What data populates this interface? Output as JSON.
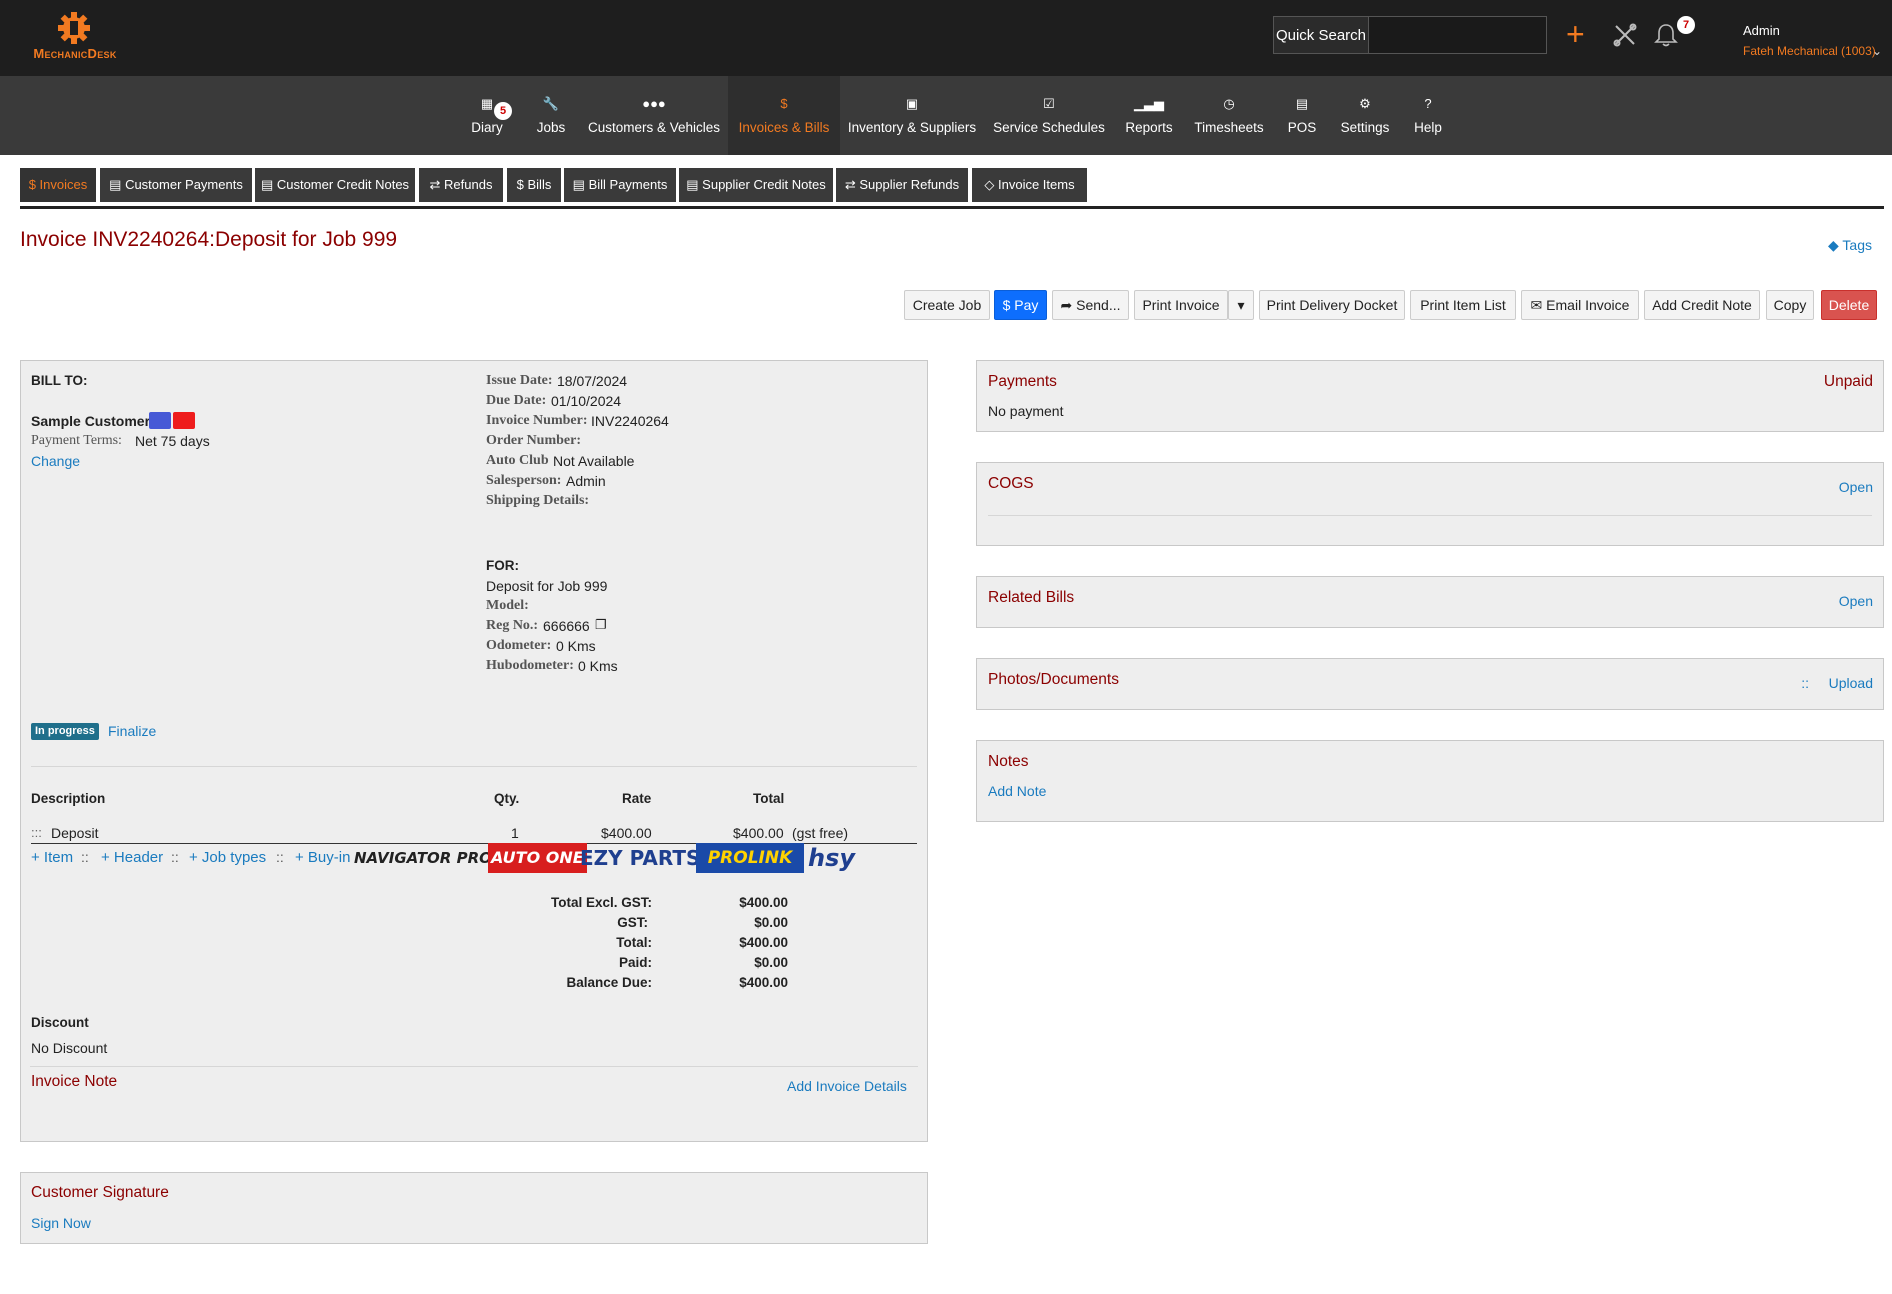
{
  "app": {
    "logo_text": "MechanicDesk"
  },
  "header": {
    "quick_search_label": "Quick Search",
    "quick_search_value": "",
    "notification_count": "7",
    "user_name": "Admin",
    "user_org": "Fateh Mechanical (1003)"
  },
  "nav": {
    "items": [
      {
        "label": "Diary",
        "icon": "calendar-icon",
        "badge": "5"
      },
      {
        "label": "Jobs",
        "icon": "wrench-icon"
      },
      {
        "label": "Customers & Vehicles",
        "icon": "users-icon"
      },
      {
        "label": "Invoices & Bills",
        "icon": "dollar-icon",
        "active": true
      },
      {
        "label": "Inventory & Suppliers",
        "icon": "warehouse-icon"
      },
      {
        "label": "Service Schedules",
        "icon": "calendar-check-icon"
      },
      {
        "label": "Reports",
        "icon": "chart-icon"
      },
      {
        "label": "Timesheets",
        "icon": "clock-icon"
      },
      {
        "label": "POS",
        "icon": "store-icon"
      },
      {
        "label": "Settings",
        "icon": "gear-icon"
      },
      {
        "label": "Help",
        "icon": "question-icon"
      }
    ]
  },
  "subtabs": {
    "items": [
      {
        "label": "$ Invoices",
        "active": true
      },
      {
        "label": "Customer Payments"
      },
      {
        "label": "Customer Credit Notes"
      },
      {
        "label": "Refunds"
      },
      {
        "label": "$ Bills"
      },
      {
        "label": "Bill Payments"
      },
      {
        "label": "Supplier Credit Notes"
      },
      {
        "label": "Supplier Refunds"
      },
      {
        "label": "Invoice Items"
      }
    ]
  },
  "page": {
    "title": "Invoice INV2240264:Deposit for Job 999",
    "tags_label": "Tags"
  },
  "actions": {
    "create_job": "Create Job",
    "pay": "$ Pay",
    "send": "Send...",
    "print_invoice": "Print Invoice",
    "print_delivery_docket": "Print Delivery Docket",
    "print_item_list": "Print Item List",
    "email_invoice": "Email Invoice",
    "add_credit_note": "Add Credit Note",
    "copy": "Copy",
    "delete": "Delete"
  },
  "bill_to": {
    "heading": "BILL TO:",
    "customer_name": "Sample Customer",
    "payment_terms_label": "Payment Terms:",
    "payment_terms": "Net 75 days",
    "change_label": "Change"
  },
  "invoice_info": {
    "issue_date_label": "Issue Date:",
    "issue_date": "18/07/2024",
    "due_date_label": "Due Date:",
    "due_date": "01/10/2024",
    "invoice_number_label": "Invoice Number:",
    "invoice_number": "INV2240264",
    "order_number_label": "Order Number:",
    "auto_club_label": "Auto Club",
    "auto_club": "Not Available",
    "salesperson_label": "Salesperson:",
    "salesperson": "Admin",
    "shipping_label": "Shipping Details:"
  },
  "for_info": {
    "heading": "FOR:",
    "description": "Deposit for Job 999",
    "model_label": "Model:",
    "reg_label": "Reg No.:",
    "reg": "666666",
    "odometer_label": "Odometer:",
    "odometer": "0 Kms",
    "hubodometer_label": "Hubodometer:",
    "hubodometer": "0 Kms"
  },
  "status": {
    "badge": "In progress",
    "finalize_label": "Finalize"
  },
  "items_table": {
    "headers": [
      "Description",
      "Qty.",
      "Rate",
      "Total"
    ],
    "rows": [
      {
        "handle": ":::",
        "description": "Deposit",
        "qty": "1",
        "rate": "$400.00",
        "total": "$400.00",
        "note": "(gst free)"
      }
    ],
    "add_links": [
      "+ Item",
      "+ Header",
      "+ Job types",
      "+ Buy-in"
    ],
    "separator": "::",
    "suppliers": [
      "NAVIGATOR PRO",
      "AUTO ONE",
      "EZY PARTS",
      "PROLINK",
      "hsy"
    ]
  },
  "totals": [
    {
      "label": "Total Excl. GST:",
      "value": "$400.00"
    },
    {
      "label": "GST:",
      "value": "$0.00"
    },
    {
      "label": "Total:",
      "value": "$400.00"
    },
    {
      "label": "Paid:",
      "value": "$0.00"
    },
    {
      "label": "Balance Due:",
      "value": "$400.00"
    }
  ],
  "discount": {
    "heading": "Discount",
    "value": "No Discount"
  },
  "invoice_note": {
    "title": "Invoice Note",
    "add_details": "Add Invoice Details"
  },
  "signature": {
    "title": "Customer Signature",
    "sign_now": "Sign Now"
  },
  "right_panels": {
    "payments": {
      "title": "Payments",
      "status": "Unpaid",
      "content": "No payment"
    },
    "cogs": {
      "title": "COGS",
      "action": "Open"
    },
    "related_bills": {
      "title": "Related Bills",
      "action": "Open"
    },
    "photos": {
      "title": "Photos/Documents",
      "action": "Upload",
      "handle": "::"
    },
    "notes": {
      "title": "Notes",
      "action": "Add Note"
    }
  },
  "colors": {
    "accent_orange": "#f27a21",
    "title_red": "#8b0000",
    "link_blue": "#1a7bbf",
    "primary_blue": "#0d6efd",
    "danger_red": "#d9534f",
    "status_badge": "#1f6f8b"
  }
}
